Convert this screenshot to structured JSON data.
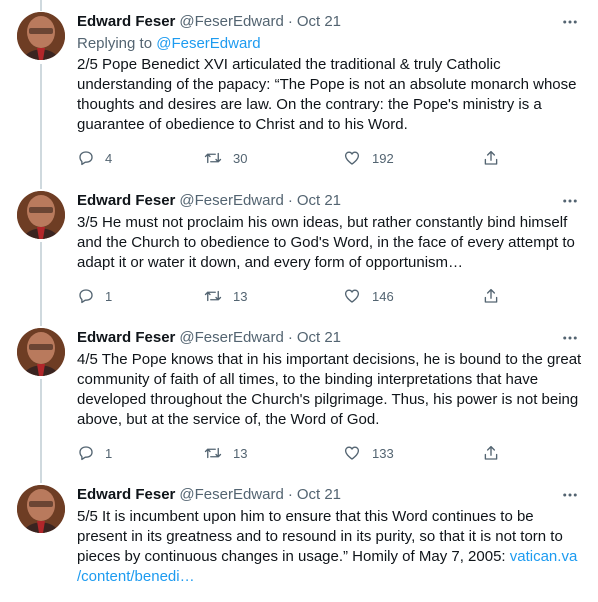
{
  "tweets": [
    {
      "name": "Edward Feser",
      "handle": "@FeserEdward",
      "separator": "·",
      "date": "Oct 21",
      "replying_prefix": "Replying to ",
      "replying_to": "@FeserEdward",
      "text": "2/5 Pope Benedict XVI articulated the traditional & truly Catholic understanding of the papacy: “The Pope is not an absolute monarch whose thoughts and desires are law. On the contrary: the Pope's ministry is a guarantee of obedience to Christ and to his Word.",
      "replies": "4",
      "retweets": "30",
      "likes": "192"
    },
    {
      "name": "Edward Feser",
      "handle": "@FeserEdward",
      "separator": "·",
      "date": "Oct 21",
      "text": "3/5 He must not proclaim his own ideas, but rather constantly bind himself and the Church to obedience to God's Word, in the face of every attempt to adapt it or water it down, and every form of opportunism…",
      "replies": "1",
      "retweets": "13",
      "likes": "146"
    },
    {
      "name": "Edward Feser",
      "handle": "@FeserEdward",
      "separator": "·",
      "date": "Oct 21",
      "text": "4/5 The Pope knows that in his important decisions, he is bound to the great community of faith of all times, to the binding interpretations that have developed throughout the Church's pilgrimage. Thus, his power is not being above, but at the service of, the Word of God.",
      "replies": "1",
      "retweets": "13",
      "likes": "133"
    },
    {
      "name": "Edward Feser",
      "handle": "@FeserEdward",
      "separator": "·",
      "date": "Oct 21",
      "text": "5/5 It is incumbent upon him to ensure that this Word continues to be present in its greatness and to resound in its purity, so that it is not torn to pieces by continuous changes in usage.” Homily of May 7, 2005: ",
      "link_line1": "vatican.va",
      "link_line2": "/content/benedi…"
    }
  ],
  "icons": {
    "more": "more-horizontal-icon",
    "reply": "reply-bubble-icon",
    "retweet": "retweet-icon",
    "like": "heart-icon",
    "share": "share-icon"
  },
  "colors": {
    "text": "#0f1419",
    "secondary": "#536471",
    "link": "#1d9bf0",
    "thread_line": "#cfd9de"
  }
}
